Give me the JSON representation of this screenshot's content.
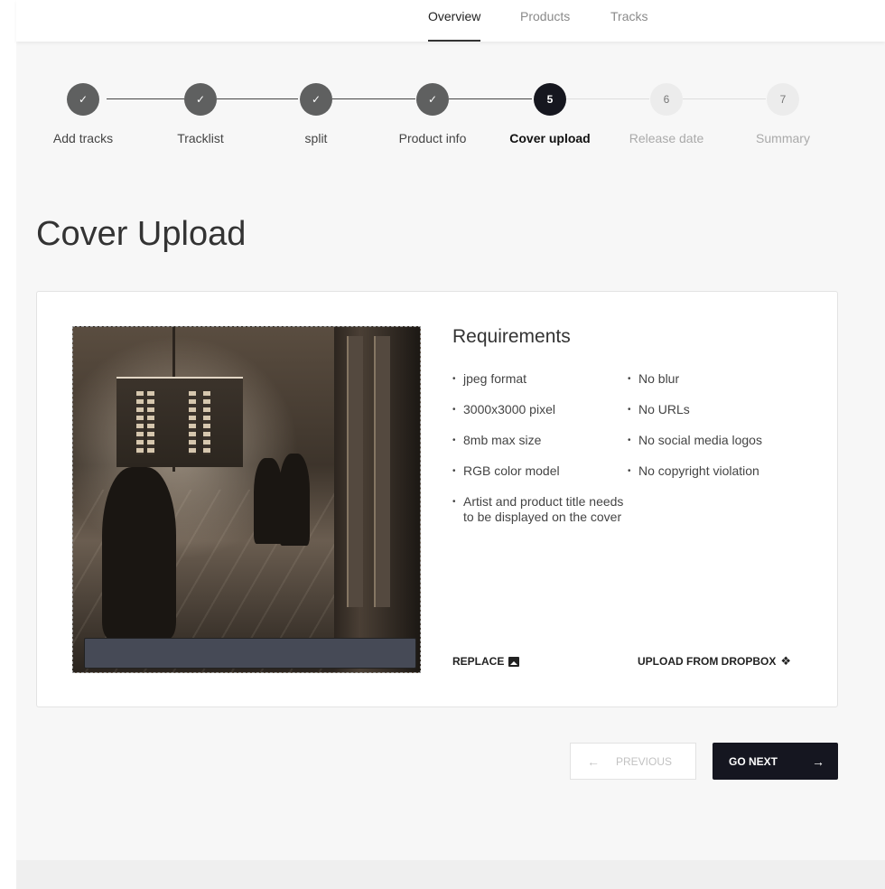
{
  "nav": {
    "tabs": [
      {
        "label": "Overview",
        "active": true
      },
      {
        "label": "Products",
        "active": false
      },
      {
        "label": "Tracks",
        "active": false
      }
    ]
  },
  "stepper": {
    "steps": [
      {
        "number": "",
        "label": "Add tracks",
        "state": "done"
      },
      {
        "number": "",
        "label": "Tracklist",
        "state": "done"
      },
      {
        "number": "",
        "label": "split",
        "state": "done"
      },
      {
        "number": "",
        "label": "Product info",
        "state": "done"
      },
      {
        "number": "5",
        "label": "Cover upload",
        "state": "current"
      },
      {
        "number": "6",
        "label": "Release date",
        "state": "future"
      },
      {
        "number": "7",
        "label": "Summary",
        "state": "future"
      }
    ],
    "check_glyph": "✓"
  },
  "page": {
    "title": "Cover Upload"
  },
  "requirements": {
    "title": "Requirements",
    "left": [
      "jpeg format",
      "3000x3000 pixel",
      "8mb max size",
      "RGB color model",
      "Artist and product title needs to be displayed on the cover"
    ],
    "right": [
      "No blur",
      "No URLs",
      "No social media logos",
      "No copyright violation"
    ]
  },
  "actions": {
    "replace_label": "REPLACE",
    "dropbox_label": "UPLOAD FROM DROPBOX"
  },
  "footer_nav": {
    "previous_label": "PREVIOUS",
    "next_label": "GO NEXT",
    "previous_arrow": "←",
    "next_arrow": "→"
  },
  "colors": {
    "primary": "#151620",
    "step_done": "#5f6060",
    "step_future": "#ececec",
    "background": "#f7f7f7"
  },
  "icons": {
    "replace": "image-icon",
    "dropbox": "dropbox-icon",
    "check": "check-icon"
  }
}
